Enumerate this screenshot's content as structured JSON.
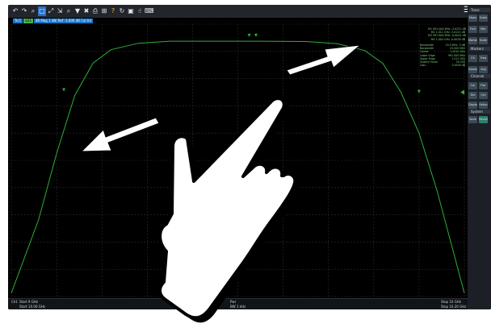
{
  "toolbar": {
    "icons": [
      "undo-icon",
      "redo-icon",
      "zoom-icon",
      "zoom-rect-icon",
      "zoom-fit-icon",
      "auto-scale-icon",
      "search-icon",
      "marker-icon",
      "trash-icon",
      "print-icon",
      "windows-icon",
      "help-icon",
      "refresh-icon",
      "screenshot-icon",
      "touch-icon",
      "keyboard-icon"
    ],
    "active_index": 3,
    "warn_index": 11
  },
  "trace_tabs": [
    {
      "label": "Trc1",
      "active": false
    },
    {
      "label": "S21",
      "active": true
    },
    {
      "label": "dB Mag  1 dB/ Ref -3.000 dB  Cal Int",
      "active": false
    }
  ],
  "markers": [
    "M1  991.000 MHz  -3.0231 dB",
    "M2  1.011 GHz  -3.0122 dB",
    "M3  997.600 MHz  -0.0042 dB",
    "M4  1.004 GHz  -0.0038 dB"
  ],
  "stats": [
    [
      "Bandwidth",
      "20.0 MHz  -3 dB"
    ],
    [
      "Bandwidth",
      "20.000 MHz"
    ],
    [
      "Center",
      "1.0010 GHz"
    ],
    [
      "Lower Edge",
      "991.000 MHz"
    ],
    [
      "Upper Edge",
      "1.011 GHz"
    ],
    [
      "Quality Factor",
      "50.050"
    ],
    [
      "Loss",
      "0.0040 dB"
    ]
  ],
  "bottom": {
    "ch_label": "Ch1",
    "start_label": "Start 9 GHz",
    "pwr_label": "Pwr",
    "bw_label": "BW  1 kHz",
    "stop_label": "Stop 10 GHz",
    "start2_label": "Start 10.00 GHz",
    "stop2_label": "Stop 10.20 GHz"
  },
  "right_panel": {
    "sections": [
      "Trace",
      "Markers",
      "Channel",
      "System"
    ],
    "buttons": [
      "Meas",
      "Scale",
      "Fmt",
      "Mkr",
      "Marker",
      "Scale",
      "Ch",
      "Freq",
      "Sweep",
      "Avg",
      "Cal",
      "Pwr",
      "File",
      "Ctrl",
      "Display",
      "Setup",
      "Save",
      "Recall"
    ]
  },
  "chart_data": {
    "type": "line",
    "series": [
      {
        "x": [
          0,
          0.06,
          0.1,
          0.14,
          0.18,
          0.22,
          0.28,
          0.35,
          0.45,
          0.55,
          0.65,
          0.72,
          0.78,
          0.82,
          0.86,
          0.9,
          0.94,
          1.0
        ],
        "values": [
          -14.8,
          -10.5,
          -6.6,
          -3.2,
          -1.3,
          -0.5,
          -0.12,
          0.0,
          0.0,
          0.0,
          -0.02,
          -0.15,
          -0.55,
          -1.3,
          -3.0,
          -5.4,
          -8.8,
          -14.8
        ]
      }
    ],
    "xlim": [
      0,
      1
    ],
    "ylim": [
      -15,
      1
    ],
    "grid": true,
    "color": "#2fae3a"
  },
  "gesture": {
    "hand": "two-finger spread hand",
    "arrows": [
      "left-arrow",
      "right-arrow"
    ]
  }
}
